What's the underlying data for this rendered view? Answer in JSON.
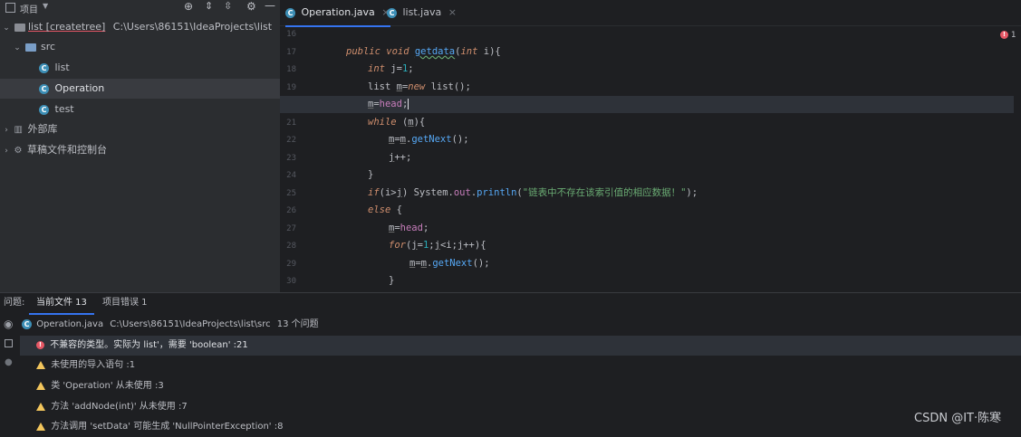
{
  "project_panel": {
    "title": "项目",
    "tree": [
      {
        "label": "list [createtree]",
        "path": "C:\\Users\\86151\\IdeaProjects\\list"
      },
      {
        "label": "src"
      },
      {
        "label": "list"
      },
      {
        "label": "Operation"
      },
      {
        "label": "test"
      },
      {
        "label": "外部库"
      },
      {
        "label": "草稿文件和控制台"
      }
    ]
  },
  "editor": {
    "tabs": [
      {
        "label": "Operation.java"
      },
      {
        "label": "list.java"
      }
    ],
    "error_count": "1",
    "line_numbers": [
      "16",
      "17",
      "18",
      "19",
      "20",
      "21",
      "22",
      "23",
      "24",
      "25",
      "26",
      "27",
      "28",
      "29",
      "30"
    ]
  },
  "problems": {
    "label": "问题:",
    "tabs": [
      {
        "label": "当前文件 13"
      },
      {
        "label": "项目错误 1"
      }
    ],
    "file": "Operation.java",
    "file_path": "C:\\Users\\86151\\IdeaProjects\\list\\src",
    "file_count": "13 个问题",
    "items": [
      {
        "text": "不兼容的类型。实际为 list'，需要 'boolean' :21",
        "level": "error"
      },
      {
        "text": "未使用的导入语句 :1",
        "level": "warning"
      },
      {
        "text": "类 'Operation' 从未使用 :3",
        "level": "warning"
      },
      {
        "text": "方法 'addNode(int)' 从未使用 :7",
        "level": "warning"
      },
      {
        "text": "方法调用 'setData' 可能生成 'NullPointerException' :8",
        "level": "warning"
      }
    ]
  },
  "watermark": "CSDN @IT·陈寒"
}
